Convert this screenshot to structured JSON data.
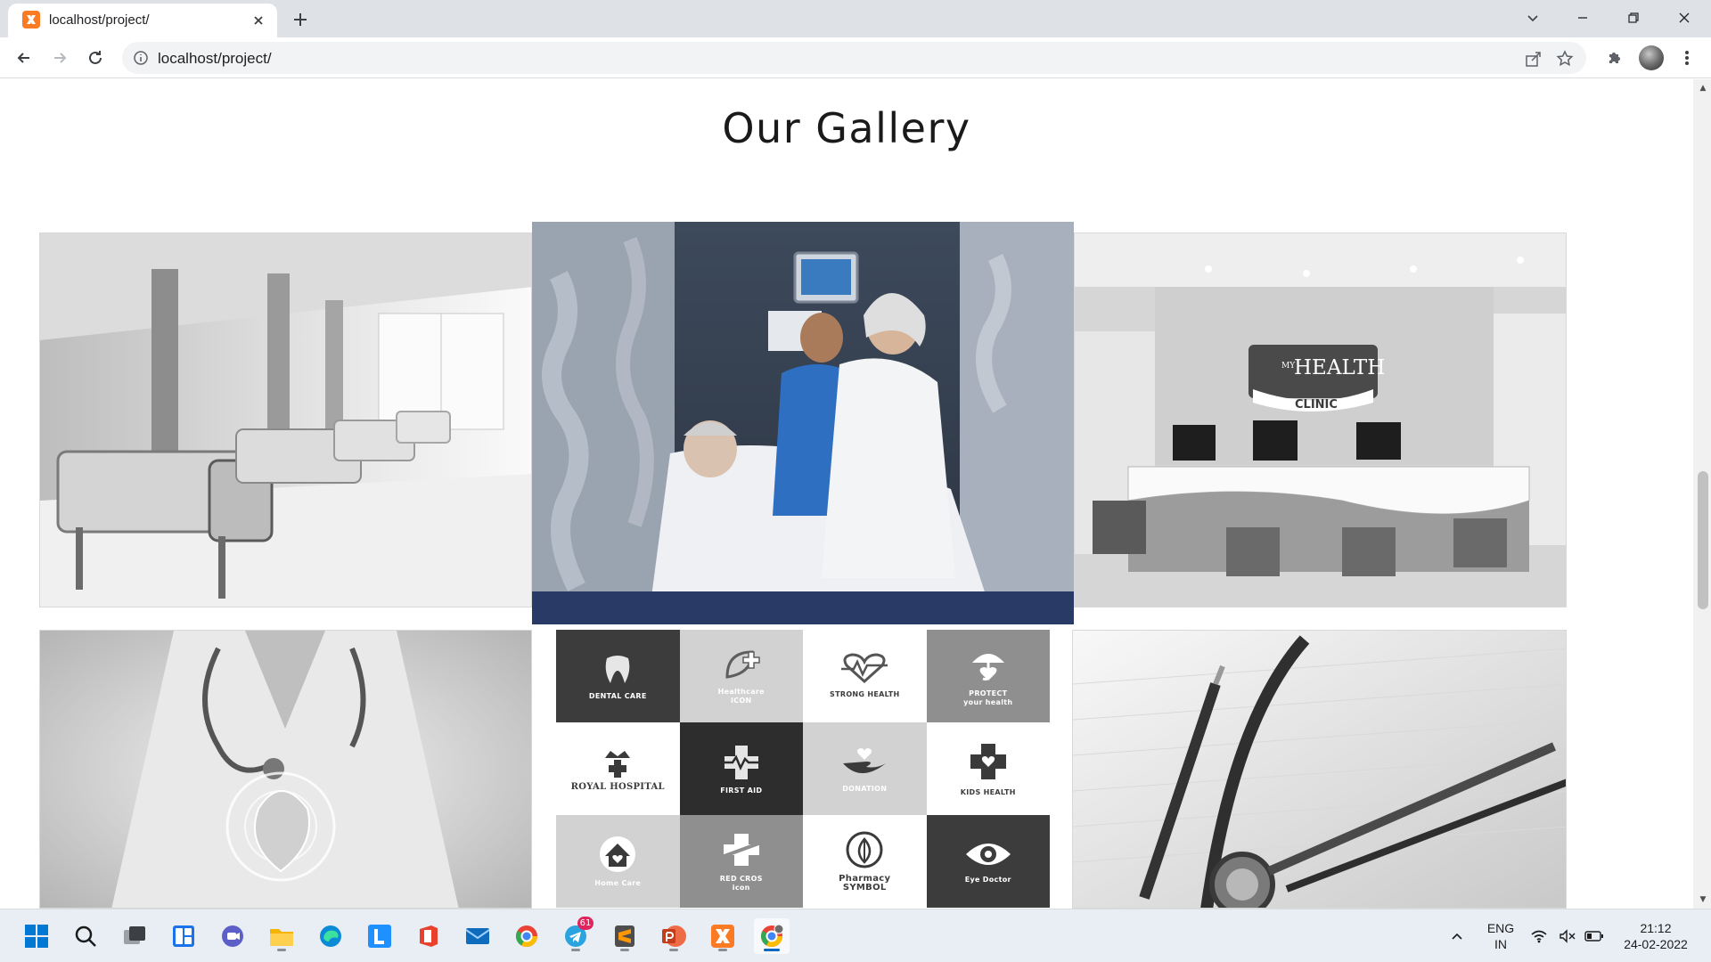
{
  "browser": {
    "tab_title": "localhost/project/",
    "url": "localhost/project/"
  },
  "page": {
    "gallery_title": "Our Gallery"
  },
  "photos": [
    {
      "name": "hospital-ward-photo"
    },
    {
      "name": "doctors-with-patient-photo"
    },
    {
      "name": "clinic-reception-photo",
      "sign_my": "MY",
      "sign_health": "HEALTH",
      "sign_clinic": "CLINIC"
    },
    {
      "name": "doctor-heart-photo"
    },
    {
      "name": "medical-logos-grid"
    },
    {
      "name": "stethoscope-pen-photo"
    }
  ],
  "logos": [
    {
      "label": "DENTAL CARE",
      "tone": "c-dark",
      "icon": "tooth-icon"
    },
    {
      "label": "Healthcare\nICON",
      "tone": "c-light",
      "icon": "leaf-cross-icon"
    },
    {
      "label": "STRONG HEALTH",
      "tone": "c-white",
      "icon": "heartbeat-icon"
    },
    {
      "label": "PROTECT\nyour health",
      "tone": "c-mid",
      "icon": "umbrella-heart-icon"
    },
    {
      "label": "ROYAL HOSPITAL",
      "tone": "c-white",
      "icon": "crown-cross-icon"
    },
    {
      "label": "FIRST AID",
      "tone": "c-black",
      "icon": "cross-pulse-icon"
    },
    {
      "label": "DONATION",
      "tone": "c-light",
      "icon": "hand-heart-icon"
    },
    {
      "label": "KIDS HEALTH",
      "tone": "c-white",
      "icon": "cross-hearts-icon"
    },
    {
      "label": "Home Care",
      "tone": "c-light",
      "icon": "house-icon"
    },
    {
      "label": "RED CROS\nicon",
      "tone": "c-mid",
      "icon": "split-cross-icon"
    },
    {
      "label": "Pharmacy\nSYMBOL",
      "tone": "c-white",
      "icon": "leaf-circle-icon"
    },
    {
      "label": "Eye Doctor",
      "tone": "c-dark",
      "icon": "eye-icon"
    }
  ],
  "taskbar": {
    "telegram_badge": "61",
    "lang_line1": "ENG",
    "lang_line2": "IN",
    "time": "21:12",
    "date": "24-02-2022"
  }
}
